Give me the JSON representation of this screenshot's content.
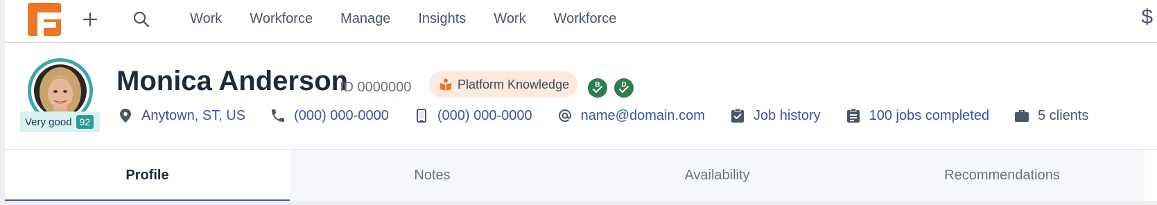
{
  "colors": {
    "accent": "#4356c2",
    "brand": "#f07a2a",
    "teal": "#3ea6a6",
    "link": "#3a53a8"
  },
  "nav": {
    "icons": [
      "plus-icon",
      "search-icon",
      "dollar-icon"
    ],
    "items": [
      "Work",
      "Workforce",
      "Manage",
      "Insights",
      "Work",
      "Workforce"
    ],
    "dollar": "$"
  },
  "profile": {
    "name": "Monica Anderson",
    "id_text": "ID 0000000",
    "rating": {
      "label": "Very good",
      "score": "92"
    },
    "knowledge_badge": "Platform Knowledge",
    "certifications": [
      "B",
      "D"
    ],
    "info": {
      "location": "Anytown, ST, US",
      "phone": "(000) 000-0000",
      "mobile": "(000) 000-0000",
      "email": "name@domain.com",
      "job_history": "Job history",
      "jobs_completed": "100 jobs completed",
      "clients": "5 clients"
    }
  },
  "tabs": [
    "Profile",
    "Notes",
    "Availability",
    "Recommendations"
  ],
  "active_tab": "Profile"
}
